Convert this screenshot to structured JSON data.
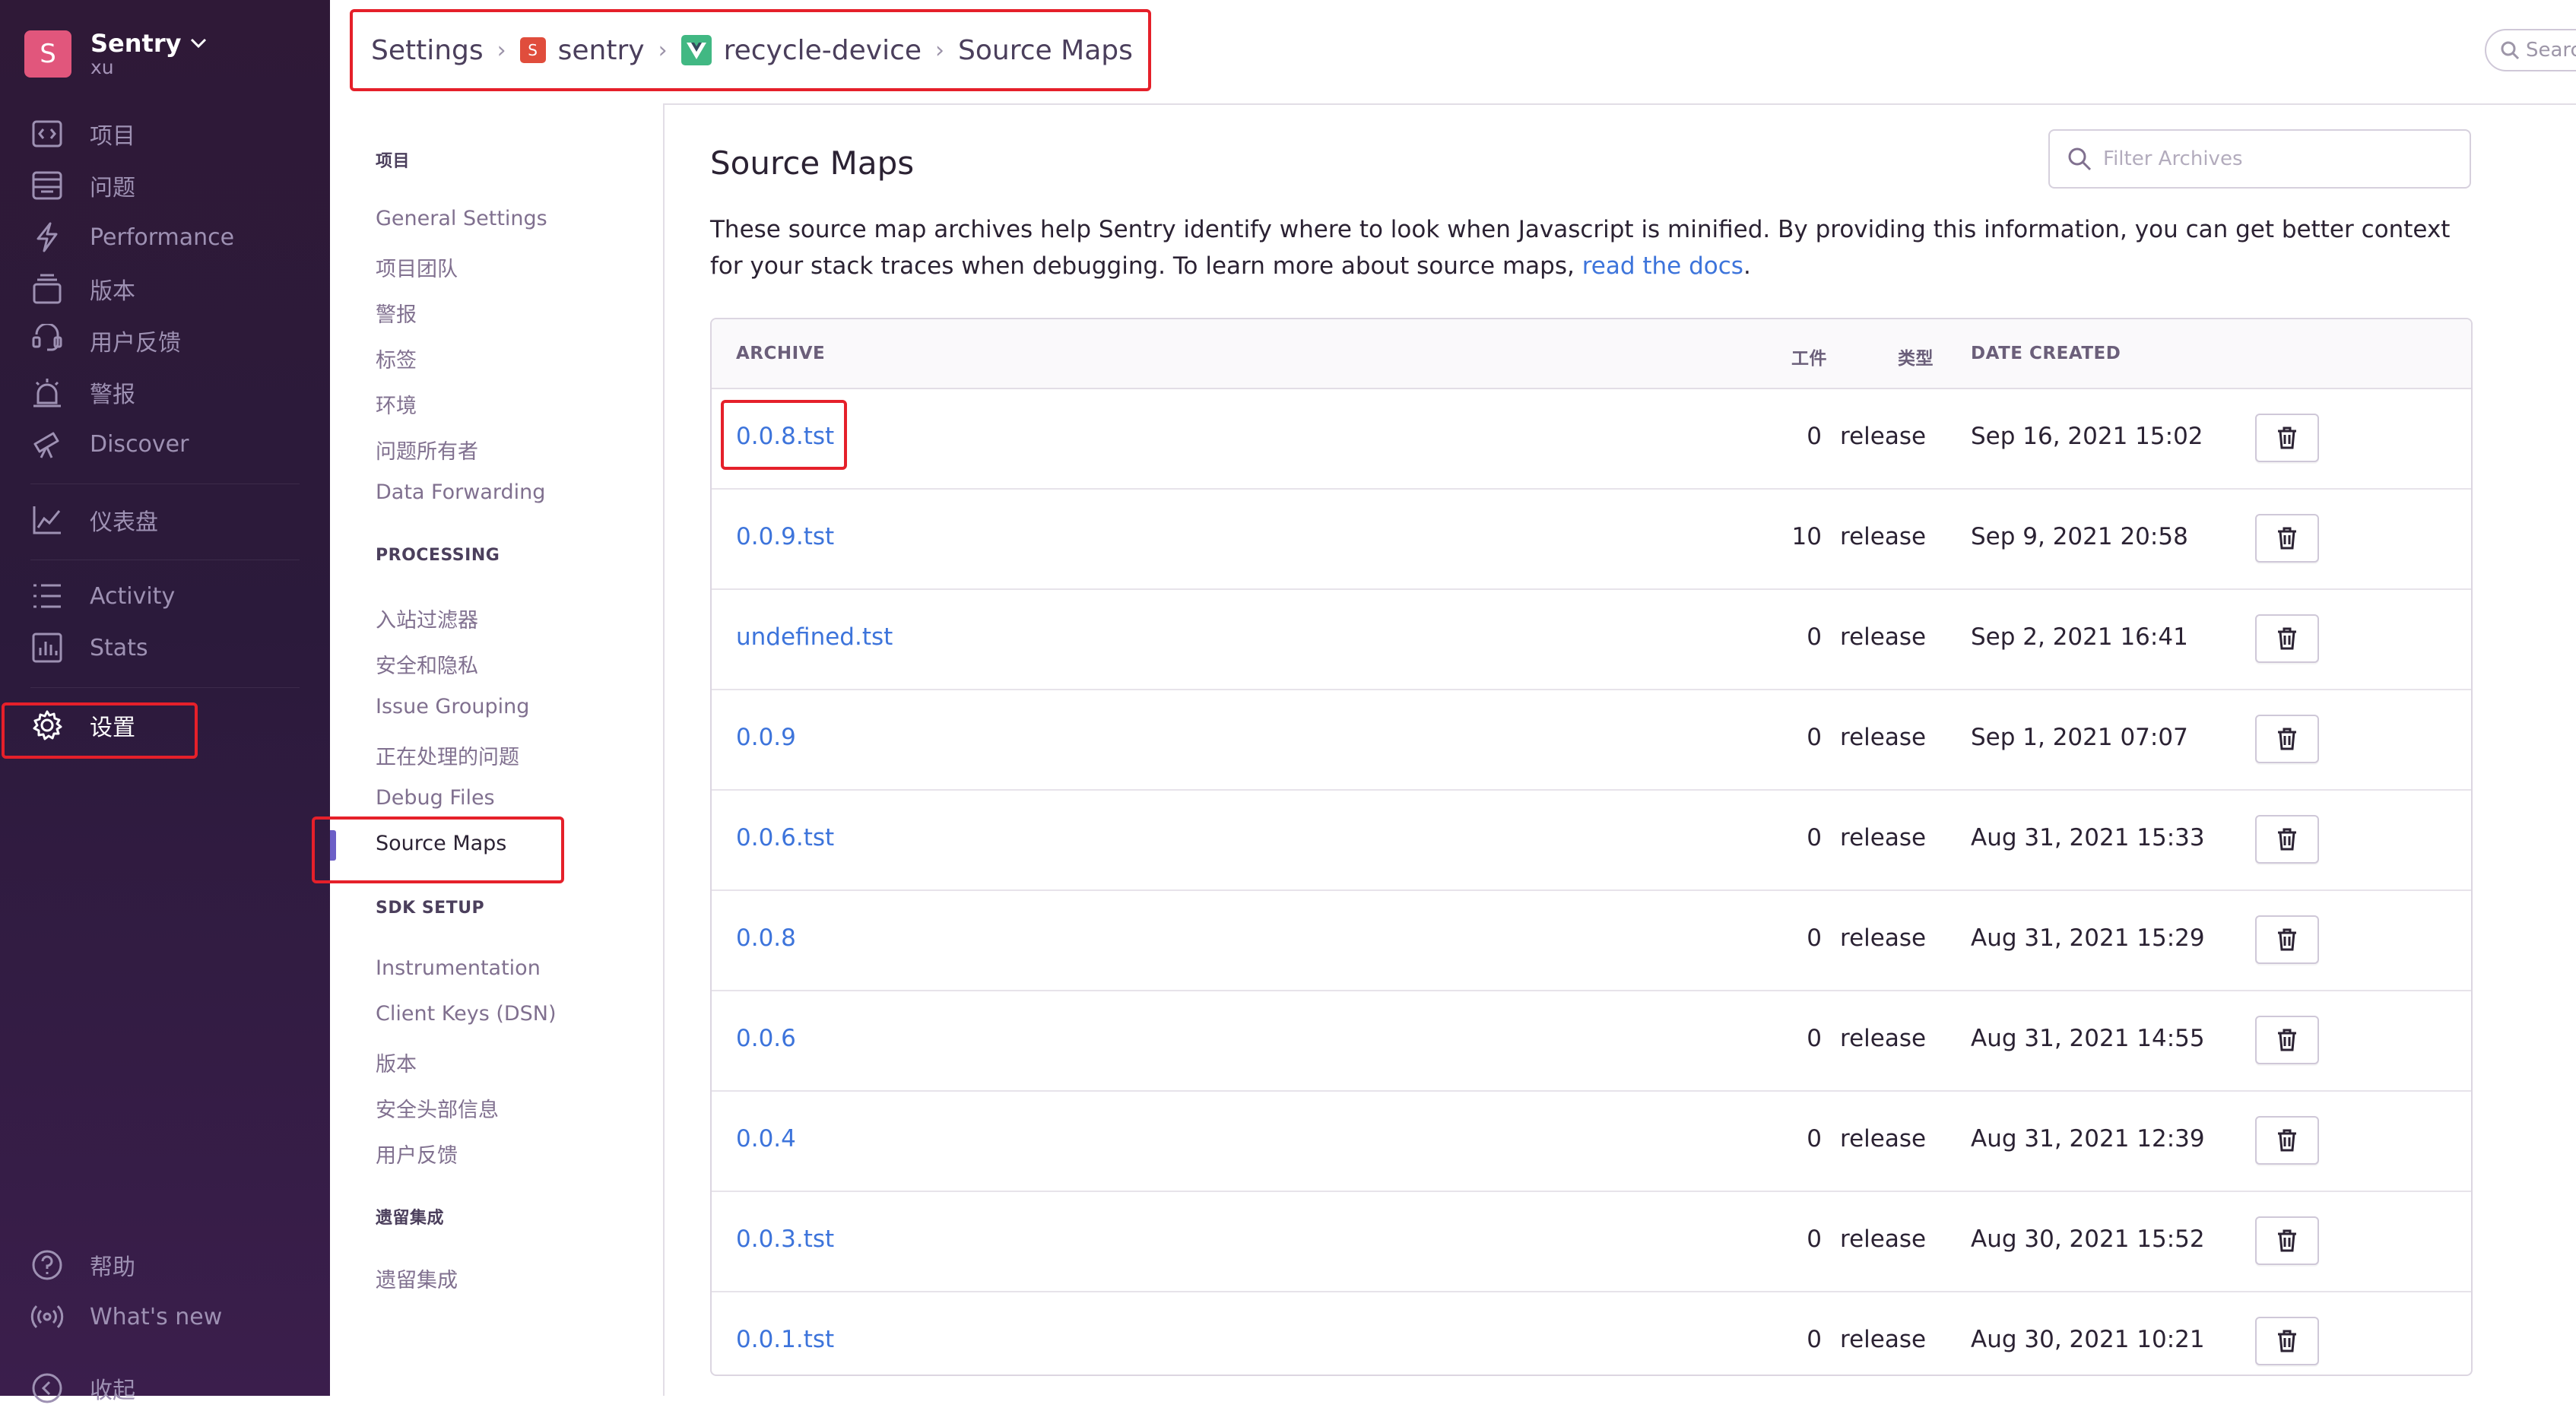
{
  "org": {
    "avatar_letter": "S",
    "name": "Sentry",
    "user": "xu"
  },
  "sidebar": {
    "items": [
      {
        "label": "项目",
        "icon": "projects-icon"
      },
      {
        "label": "问题",
        "icon": "issues-icon"
      },
      {
        "label": "Performance",
        "icon": "lightning-icon"
      },
      {
        "label": "版本",
        "icon": "releases-icon"
      },
      {
        "label": "用户反馈",
        "icon": "user-feedback-icon"
      },
      {
        "label": "警报",
        "icon": "alarm-icon"
      },
      {
        "label": "Discover",
        "icon": "telescope-icon"
      },
      {
        "label": "仪表盘",
        "icon": "dashboard-icon"
      },
      {
        "label": "Activity",
        "icon": "list-icon"
      },
      {
        "label": "Stats",
        "icon": "stats-icon"
      },
      {
        "label": "设置",
        "icon": "gear-icon"
      }
    ],
    "bottom": [
      {
        "label": "帮助",
        "icon": "question-icon"
      },
      {
        "label": "What's new",
        "icon": "broadcast-icon"
      },
      {
        "label": "收起",
        "icon": "collapse-icon"
      }
    ]
  },
  "breadcrumb": [
    "Settings",
    "sentry",
    "recycle-device",
    "Source Maps"
  ],
  "project_badge_letter": "S",
  "top_search_placeholder": "Search",
  "subnav": {
    "section1": "项目",
    "section1_items": [
      "General Settings",
      "项目团队",
      "警报",
      "标签",
      "环境",
      "问题所有者",
      "Data Forwarding"
    ],
    "section2": "PROCESSING",
    "section2_items": [
      "入站过滤器",
      "安全和隐私",
      "Issue Grouping",
      "正在处理的问题",
      "Debug Files",
      "Source Maps"
    ],
    "section3": "SDK SETUP",
    "section3_items": [
      "Instrumentation",
      "Client Keys (DSN)",
      "版本",
      "安全头部信息",
      "用户反馈"
    ],
    "section4": "遗留集成",
    "section4_items": [
      "遗留集成"
    ]
  },
  "main": {
    "title": "Source Maps",
    "filter_placeholder": "Filter Archives",
    "description": "These source map archives help Sentry identify where to look when Javascript is minified. By providing this information, you can get better context for your stack traces when debugging. To learn more about source maps,",
    "docs_link": "read the docs",
    "description_end": "."
  },
  "table": {
    "headers": {
      "archive": "ARCHIVE",
      "artifacts": "工件",
      "type": "类型",
      "date": "DATE CREATED"
    },
    "rows": [
      {
        "archive": "0.0.8.tst",
        "artifacts": "0",
        "type": "release",
        "date": "Sep 16, 2021 15:02"
      },
      {
        "archive": "0.0.9.tst",
        "artifacts": "10",
        "type": "release",
        "date": "Sep 9, 2021 20:58"
      },
      {
        "archive": "undefined.tst",
        "artifacts": "0",
        "type": "release",
        "date": "Sep 2, 2021 16:41"
      },
      {
        "archive": "0.0.9",
        "artifacts": "0",
        "type": "release",
        "date": "Sep 1, 2021 07:07"
      },
      {
        "archive": "0.0.6.tst",
        "artifacts": "0",
        "type": "release",
        "date": "Aug 31, 2021 15:33"
      },
      {
        "archive": "0.0.8",
        "artifacts": "0",
        "type": "release",
        "date": "Aug 31, 2021 15:29"
      },
      {
        "archive": "0.0.6",
        "artifacts": "0",
        "type": "release",
        "date": "Aug 31, 2021 14:55"
      },
      {
        "archive": "0.0.4",
        "artifacts": "0",
        "type": "release",
        "date": "Aug 31, 2021 12:39"
      },
      {
        "archive": "0.0.3.tst",
        "artifacts": "0",
        "type": "release",
        "date": "Aug 30, 2021 15:52"
      },
      {
        "archive": "0.0.1.tst",
        "artifacts": "0",
        "type": "release",
        "date": "Aug 30, 2021 10:21"
      }
    ]
  },
  "colors": {
    "sidebar": "#2f1937",
    "accent": "#6c5fc7",
    "link": "#3d74db",
    "highlight": "#e5202a"
  }
}
